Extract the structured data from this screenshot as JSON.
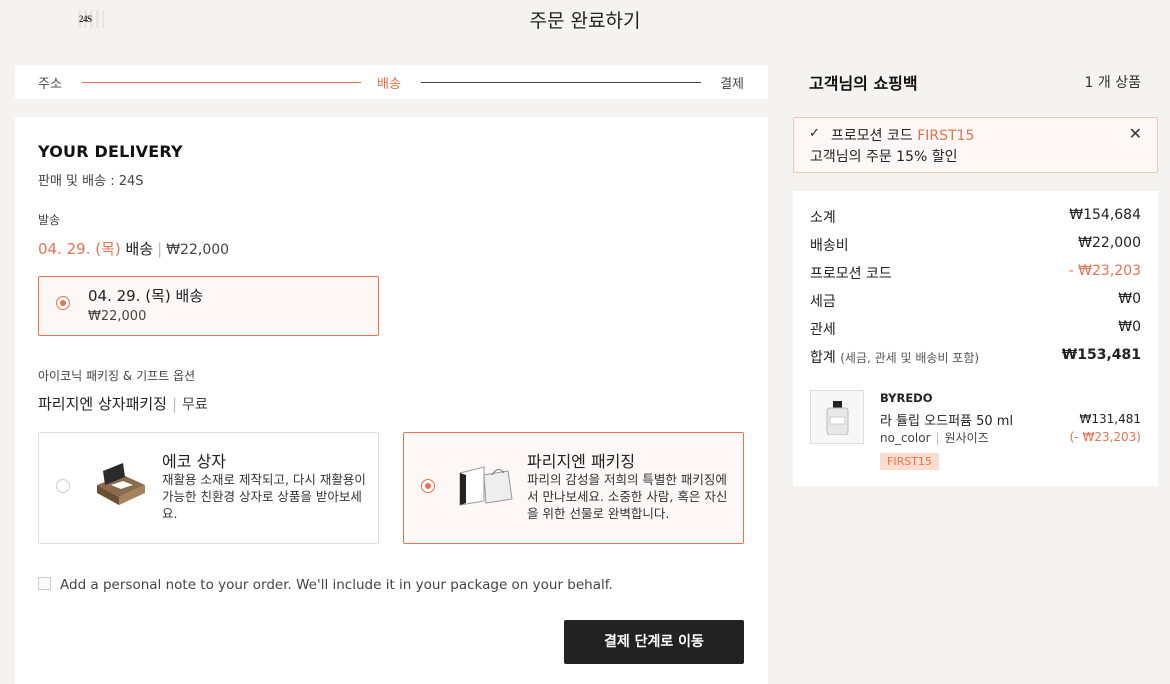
{
  "header": {
    "logo": "24S",
    "title": "주문 완료하기"
  },
  "steps": [
    "주소",
    "배송",
    "결제"
  ],
  "delivery": {
    "title": "YOUR DELIVERY",
    "sub": "판매 및 배송 : 24S",
    "ship_label": "발송",
    "ship_date": "04. 29. (목)",
    "ship_word": "배송",
    "ship_price": "₩22,000",
    "option": {
      "label": "04. 29. (목) 배송",
      "price": "₩22,000"
    }
  },
  "packaging": {
    "label": "아이코닉 패키징 & 기프트 옵션",
    "selected": "파리지엔 상자패키징",
    "price": "무료",
    "options": [
      {
        "title": "에코 상자",
        "desc": "재활용 소재로 제작되고, 다시 재활용이 가능한 친환경 상자로 상품을 받아보세요."
      },
      {
        "title": "파리지엔 패키징",
        "desc": "파리의 감성을 저희의 특별한 패키징에서 만나보세요. 소중한 사람, 혹은 자신을 위한 선물로 완벽합니다."
      }
    ]
  },
  "note": "Add a personal note to your order. We'll include it in your package on your behalf.",
  "cta": "결제 단계로 이동",
  "bag": {
    "title": "고객님의 쇼핑백",
    "count": "1 개 상품"
  },
  "promo": {
    "label": "프로모션 코드",
    "code": "FIRST15",
    "desc": "고객님의 주문 15% 할인",
    "check_icon": "✓",
    "close_icon": "✕"
  },
  "summary": {
    "rows": [
      {
        "label": "소계",
        "value": "₩154,684"
      },
      {
        "label": "배송비",
        "value": "₩22,000"
      },
      {
        "label": "프로모션 코드",
        "value": "- ₩23,203"
      },
      {
        "label": "세금",
        "value": "₩0"
      },
      {
        "label": "관세",
        "value": "₩0"
      }
    ],
    "total": {
      "label": "합계",
      "note": "(세금, 관세 및 배송비 포함)",
      "value": "₩153,481"
    }
  },
  "product": {
    "brand": "BYREDO",
    "name": "라 튤립 오드퍼퓸 50 ml",
    "color": "no_color",
    "size": "원사이즈",
    "price": "₩131,481",
    "discount": "(- ₩23,203)",
    "tag": "FIRST15"
  },
  "colors": {
    "accent": "#e8724d",
    "dark": "#222222",
    "bg": "#f4f3f1"
  }
}
